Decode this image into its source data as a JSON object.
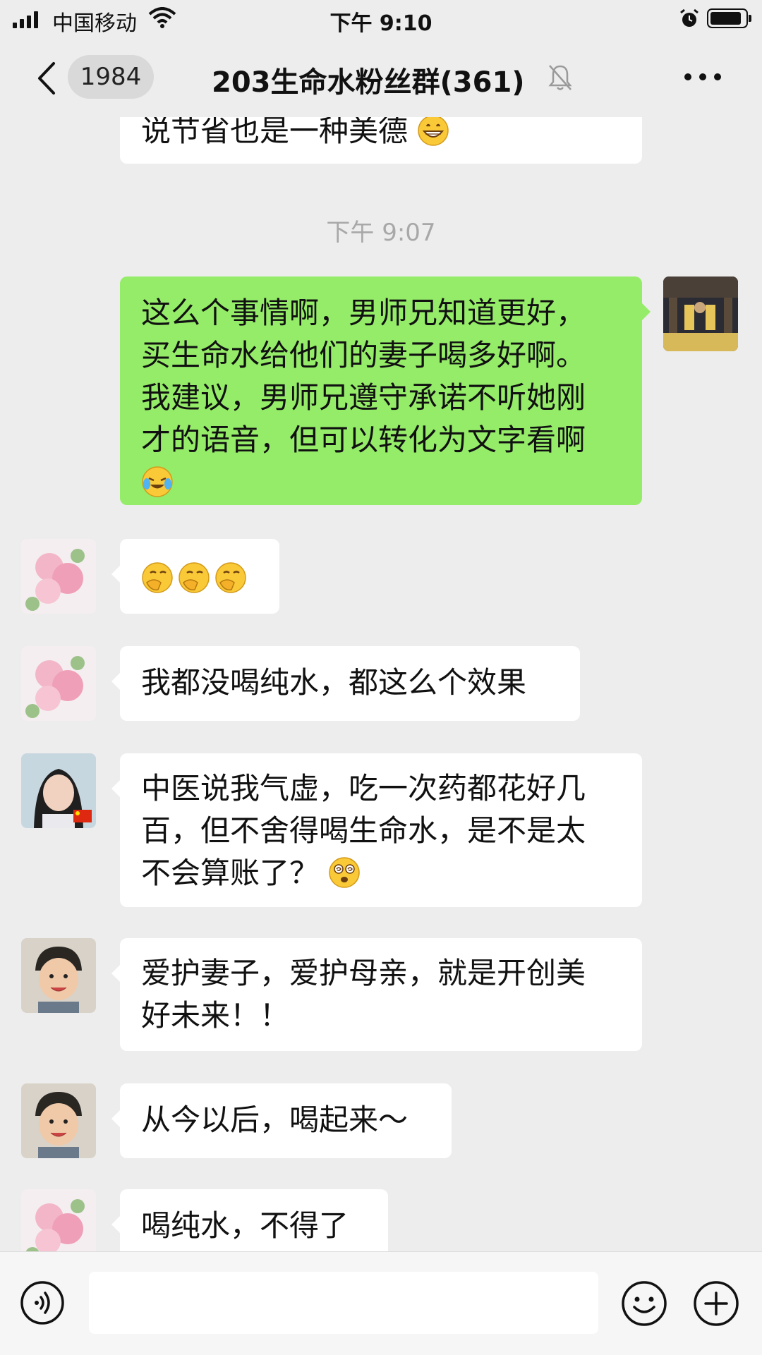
{
  "status_bar": {
    "carrier": "中国移动",
    "time": "下午 9:10",
    "battery_level": 0.9,
    "icons": [
      "signal-icon",
      "wifi-icon",
      "alarm-icon",
      "battery-icon"
    ]
  },
  "nav": {
    "unread_count": "1984",
    "title": "203生命水粉丝群(361)",
    "icons": [
      "back-icon",
      "mute-icon",
      "more-icon"
    ]
  },
  "chat": {
    "messages": [
      {
        "side": "left",
        "text": "说节省也是一种美德",
        "emoji": "grin"
      },
      {
        "type": "time",
        "text": "下午 9:07"
      },
      {
        "side": "right",
        "text": "这么个事情啊，男师兄知道更好，买生命水给他们的妻子喝多好啊。我建议，男师兄遵守承诺不听她刚才的语音，但可以转化为文字看啊",
        "emoji": "laugh-cry",
        "avatar": "temple-avatar"
      },
      {
        "side": "left",
        "emoji_only": [
          "facepalm",
          "facepalm",
          "facepalm"
        ],
        "avatar": "flower-avatar"
      },
      {
        "side": "left",
        "text": "我都没喝纯水，都这么个效果",
        "avatar": "flower-avatar"
      },
      {
        "side": "left",
        "text": "中医说我气虚，吃一次药都花好几百，但不舍得喝生命水，是不是太不会算账了？",
        "emoji": "dizzy",
        "avatar": "woman-avatar"
      },
      {
        "side": "left",
        "text": "爱护妻子，爱护母亲，就是开创美好未来！！",
        "avatar": "child-avatar"
      },
      {
        "side": "left",
        "text": "从今以后，喝起来～",
        "avatar": "child-avatar"
      },
      {
        "side": "left",
        "text": "喝纯水，不得了",
        "avatar": "flower-avatar"
      }
    ],
    "lines": {
      "m1": "说节省也是一种美德",
      "m3_l1": "这么个事情啊，男师兄知道更好，",
      "m3_l2": "买生命水给他们的妻子喝多好啊。",
      "m3_l3": "我建议，男师兄遵守承诺不听她刚",
      "m3_l4": "才的语音，但可以转化为文字看啊",
      "m5": "我都没喝纯水，都这么个效果",
      "m6_l1": "中医说我气虚，吃一次药都花好几",
      "m6_l2": "百，但不舍得喝生命水，是不是太",
      "m6_l3": "不会算账了？",
      "m7_l1": "爱护妻子，爱护母亲，就是开创美",
      "m7_l2": "好未来！！",
      "m8": "从今以后，喝起来～",
      "m9": "喝纯水，不得了"
    }
  },
  "input_bar": {
    "placeholder": "",
    "icons": [
      "voice-icon",
      "emoji-icon",
      "plus-icon"
    ]
  },
  "colors": {
    "background": "#ededed",
    "bubble_self": "#95ec69",
    "bubble_other": "#ffffff",
    "timestamp": "#a8a8a8"
  }
}
